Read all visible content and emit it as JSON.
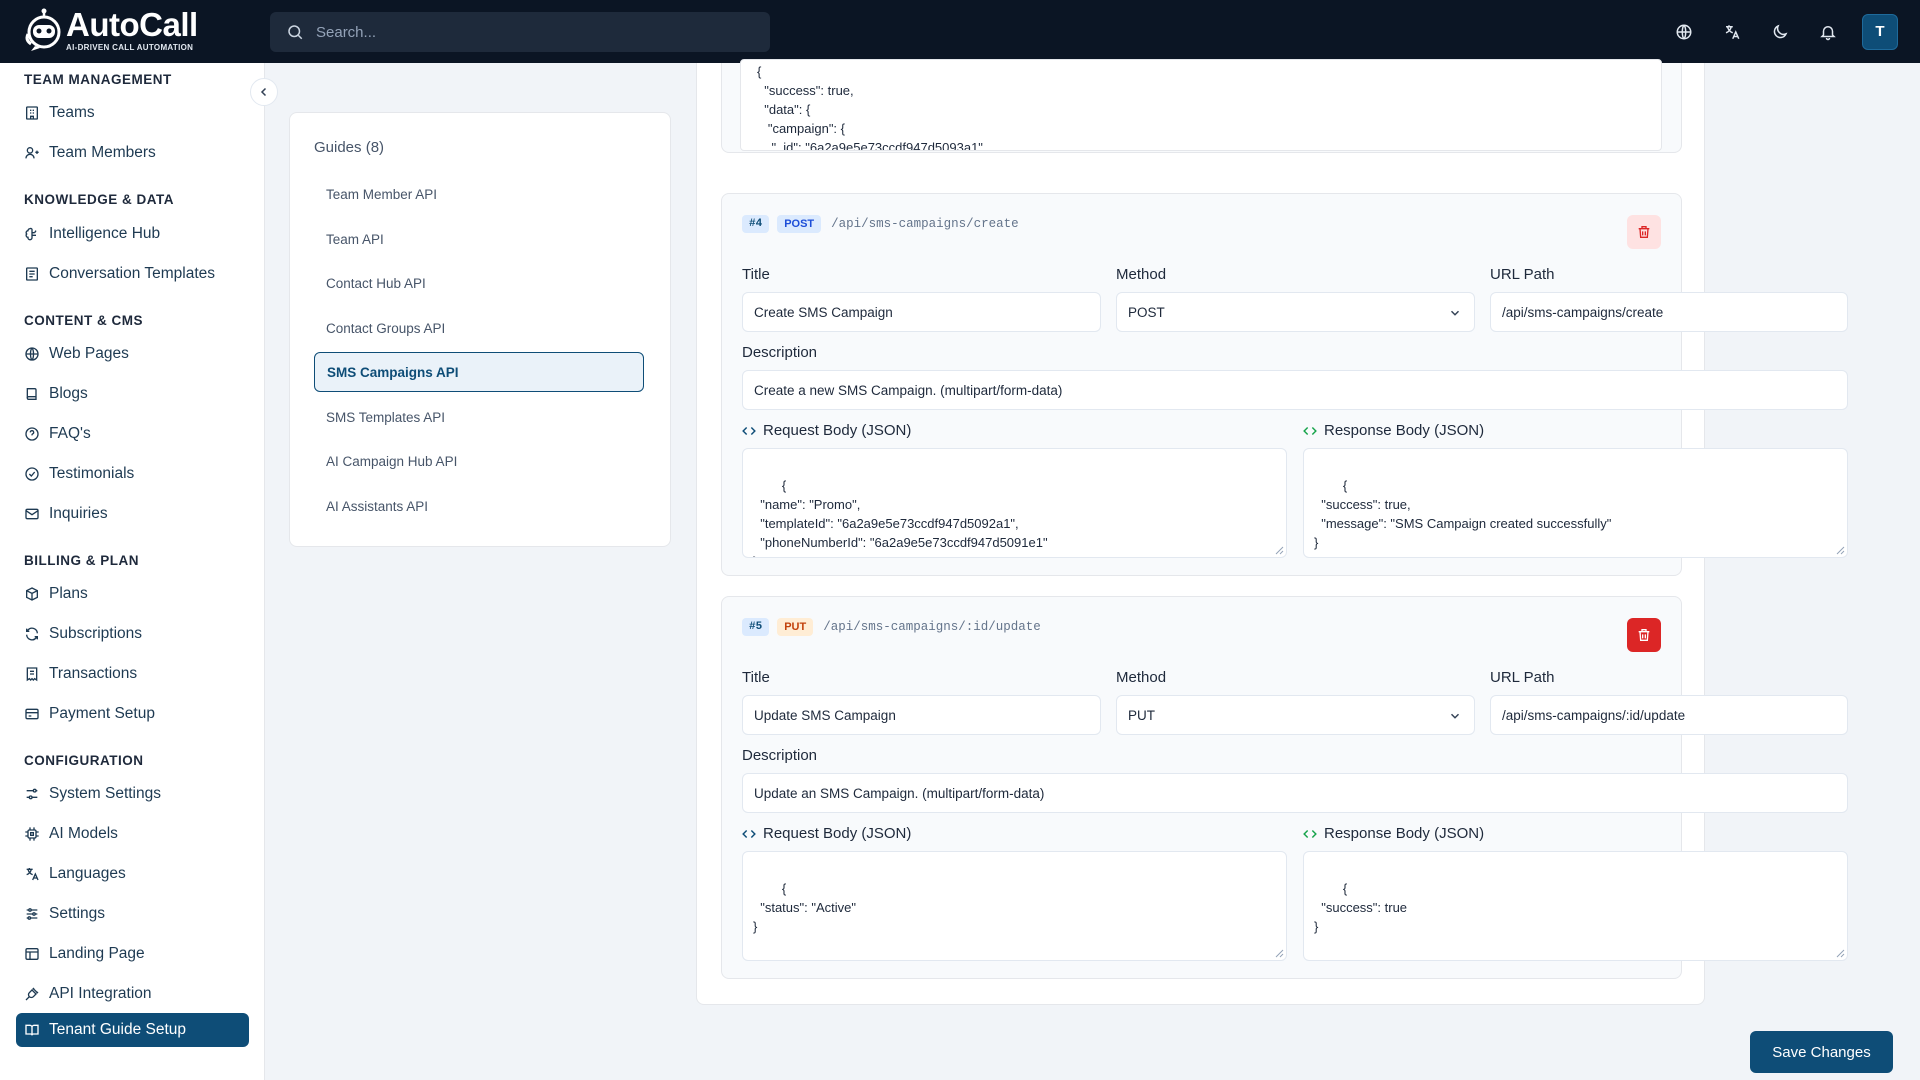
{
  "app": {
    "name": "AutoCall",
    "tagline": "AI-DRIVEN CALL AUTOMATION"
  },
  "search": {
    "placeholder": "Search..."
  },
  "user": {
    "avatar_initial": "T"
  },
  "topbar_icons": [
    "globe-icon",
    "translate-icon",
    "moon-icon",
    "bell-icon"
  ],
  "sidebar": {
    "sections": [
      {
        "title": "TEAM MANAGEMENT",
        "items": [
          {
            "label": "Teams",
            "icon": "building-icon"
          },
          {
            "label": "Team Members",
            "icon": "user-icon"
          }
        ]
      },
      {
        "title": "KNOWLEDGE & DATA",
        "items": [
          {
            "label": "Intelligence Hub",
            "icon": "brain-icon"
          },
          {
            "label": "Conversation Templates",
            "icon": "template-icon"
          }
        ]
      },
      {
        "title": "CONTENT & CMS",
        "items": [
          {
            "label": "Web Pages",
            "icon": "globe-icon"
          },
          {
            "label": "Blogs",
            "icon": "book-icon"
          },
          {
            "label": "FAQ's",
            "icon": "help-icon"
          },
          {
            "label": "Testimonials",
            "icon": "check-circle-icon"
          },
          {
            "label": "Inquiries",
            "icon": "mail-icon"
          }
        ]
      },
      {
        "title": "BILLING & PLAN",
        "items": [
          {
            "label": "Plans",
            "icon": "package-icon"
          },
          {
            "label": "Subscriptions",
            "icon": "refresh-icon"
          },
          {
            "label": "Transactions",
            "icon": "receipt-icon"
          },
          {
            "label": "Payment Setup",
            "icon": "card-icon"
          }
        ]
      },
      {
        "title": "CONFIGURATION",
        "items": [
          {
            "label": "System Settings",
            "icon": "sliders-icon"
          },
          {
            "label": "AI Models",
            "icon": "cpu-icon"
          },
          {
            "label": "Languages",
            "icon": "language-icon"
          },
          {
            "label": "Settings",
            "icon": "settings-icon"
          },
          {
            "label": "Landing Page",
            "icon": "layout-icon"
          },
          {
            "label": "API Integration",
            "icon": "plug-icon"
          },
          {
            "label": "Tenant Guide Setup",
            "icon": "book-open-icon",
            "active": true
          }
        ]
      }
    ]
  },
  "guides": {
    "title": "Guides (8)",
    "items": [
      "Team Member API",
      "Team API",
      "Contact Hub API",
      "Contact Groups API",
      "SMS Campaigns API",
      "SMS Templates API",
      "AI Campaign Hub API",
      "AI Assistants API"
    ],
    "active": "SMS Campaigns API"
  },
  "previous_response": "{\n  \"success\": true,\n  \"data\": {\n   \"campaign\": {\n    \"_id\": \"6a2a9e5e73ccdf947d5093a1\",\n    \"name\": \"SummerPromo\",",
  "labels": {
    "title": "Title",
    "method": "Method",
    "url_path": "URL Path",
    "description": "Description",
    "request_body": "Request Body (JSON)",
    "response_body": "Response Body (JSON)"
  },
  "endpoints": [
    {
      "number": "#4",
      "method": "POST",
      "path": "/api/sms-campaigns/create",
      "title": "Create SMS Campaign",
      "description": "Create a new SMS Campaign. (multipart/form-data)",
      "request_body": "{\n  \"name\": \"Promo\",\n  \"templateId\": \"6a2a9e5e73ccdf947d5092a1\",\n  \"phoneNumberId\": \"6a2a9e5e73ccdf947d5091e1\"\n}",
      "response_body": "{\n  \"success\": true,\n  \"message\": \"SMS Campaign created successfully\"\n}"
    },
    {
      "number": "#5",
      "method": "PUT",
      "path": "/api/sms-campaigns/:id/update",
      "title": "Update SMS Campaign",
      "description": "Update an SMS Campaign. (multipart/form-data)",
      "request_body": "{\n  \"status\": \"Active\"\n}",
      "response_body": "{\n  \"success\": true\n}"
    }
  ],
  "save_button": "Save Changes"
}
